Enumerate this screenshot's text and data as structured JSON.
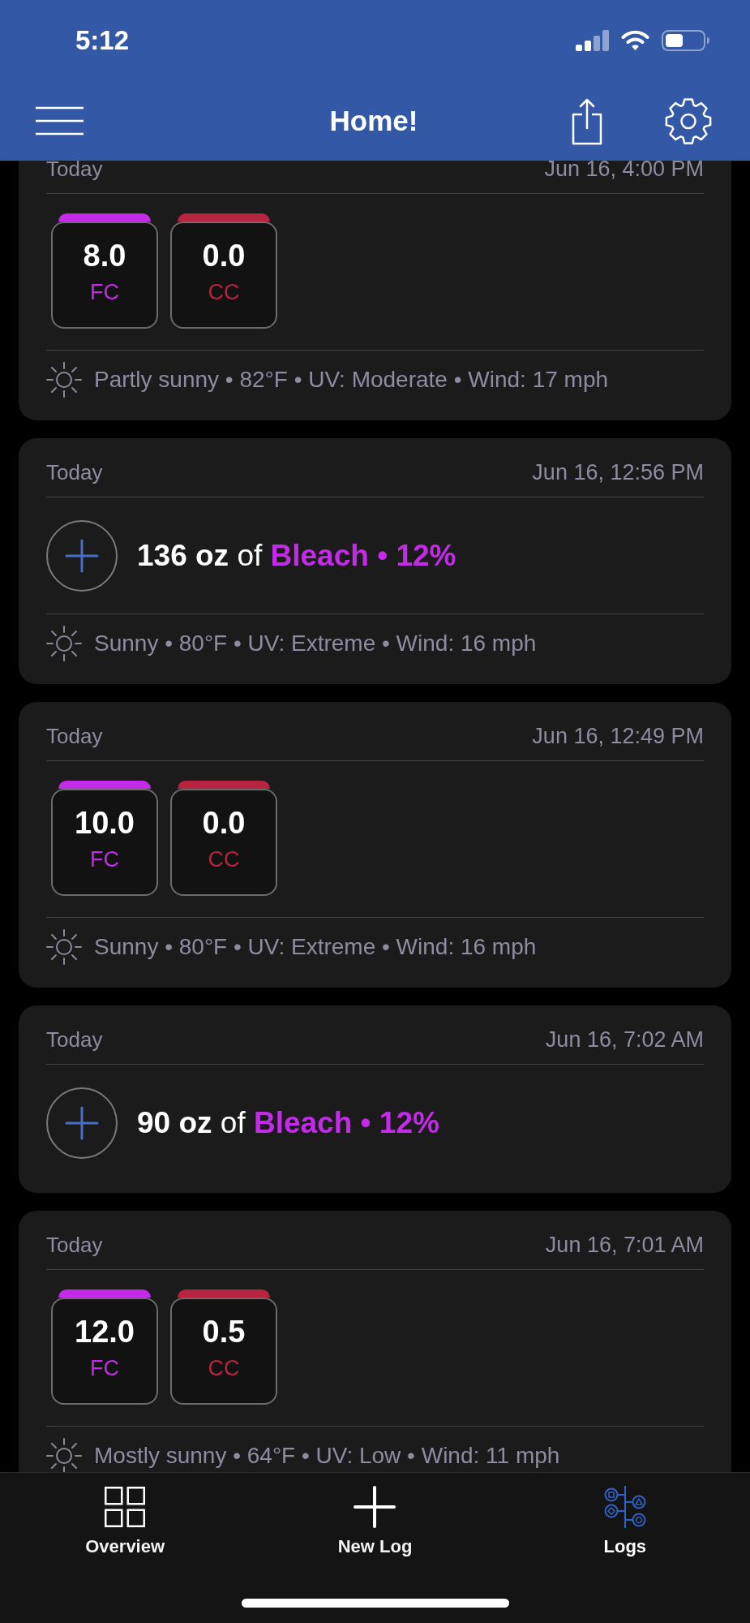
{
  "status_bar": {
    "time": "5:12"
  },
  "nav_bar": {
    "title": "Home!"
  },
  "entries": [
    {
      "kind": "reading",
      "day": "Today",
      "timestamp": "Jun 16, 4:00 PM",
      "readings": [
        {
          "value": "8.0",
          "label": "FC",
          "color": "#c42be8"
        },
        {
          "value": "0.0",
          "label": "CC",
          "color": "#b8243f"
        }
      ],
      "weather": "Partly sunny • 82°F • UV: Moderate • Wind: 17 mph"
    },
    {
      "kind": "addition",
      "day": "Today",
      "timestamp": "Jun 16, 12:56 PM",
      "amount": "136 oz",
      "connector": "of",
      "product": "Bleach • 12%",
      "weather": "Sunny • 80°F • UV: Extreme • Wind: 16 mph"
    },
    {
      "kind": "reading",
      "day": "Today",
      "timestamp": "Jun 16, 12:49 PM",
      "readings": [
        {
          "value": "10.0",
          "label": "FC",
          "color": "#c42be8"
        },
        {
          "value": "0.0",
          "label": "CC",
          "color": "#b8243f"
        }
      ],
      "weather": "Sunny • 80°F • UV: Extreme • Wind: 16 mph"
    },
    {
      "kind": "addition",
      "day": "Today",
      "timestamp": "Jun 16, 7:02 AM",
      "amount": "90 oz",
      "connector": "of",
      "product": "Bleach • 12%"
    },
    {
      "kind": "reading",
      "day": "Today",
      "timestamp": "Jun 16, 7:01 AM",
      "readings": [
        {
          "value": "12.0",
          "label": "FC",
          "color": "#c42be8"
        },
        {
          "value": "0.5",
          "label": "CC",
          "color": "#b8243f"
        }
      ],
      "weather": "Mostly sunny • 64°F • UV: Low • Wind: 11 mph"
    }
  ],
  "tab_bar": [
    {
      "label": "Overview",
      "selected": false
    },
    {
      "label": "New Log",
      "selected": false
    },
    {
      "label": "Logs",
      "selected": true
    }
  ]
}
